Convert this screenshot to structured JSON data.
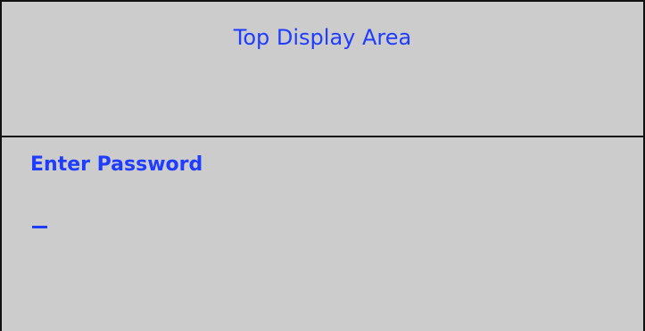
{
  "screen": {
    "top_display": {
      "title": "Top Display Area"
    },
    "password_panel": {
      "label": "Enter Password",
      "input": {
        "value": "",
        "cursor": "_"
      }
    },
    "colors": {
      "background": "#cccccc",
      "text_accent": "#1f3dff",
      "border": "#111111"
    }
  }
}
